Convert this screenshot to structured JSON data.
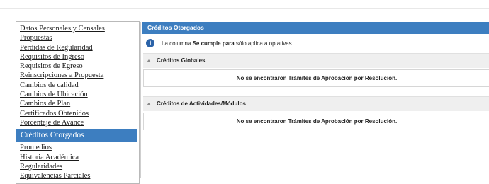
{
  "sidebar": {
    "items": [
      {
        "label": "Datos Personales y Censales",
        "active": false
      },
      {
        "label": "Propuestas",
        "active": false
      },
      {
        "label": "Pérdidas de Regularidad",
        "active": false
      },
      {
        "label": "Requisitos de Ingreso",
        "active": false
      },
      {
        "label": "Requisitos de Egreso",
        "active": false
      },
      {
        "label": "Reinscripciones a Propuesta",
        "active": false
      },
      {
        "label": "Cambios de calidad",
        "active": false
      },
      {
        "label": "Cambios de Ubicación",
        "active": false
      },
      {
        "label": "Cambios de Plan",
        "active": false
      },
      {
        "label": "Certificados Obtenidos",
        "active": false
      },
      {
        "label": "Porcentaje de Avance",
        "active": false
      },
      {
        "label": "Créditos Otorgados",
        "active": true
      },
      {
        "label": "Promedios",
        "active": false
      },
      {
        "label": "Historia Académica",
        "active": false
      },
      {
        "label": "Regularidades",
        "active": false
      },
      {
        "label": "Equivalencias Parciales",
        "active": false
      }
    ]
  },
  "main": {
    "title": "Créditos Otorgados",
    "info": {
      "prefix": "La columna",
      "bold": "Se cumple para",
      "suffix": "sólo aplica a optativas.",
      "icon": "info-icon"
    },
    "sections": [
      {
        "title": "Créditos Globales",
        "message": "No se encontraron Trámites de Aprobación por Resolución."
      },
      {
        "title": "Créditos de Actividades/Módulos",
        "message": "No se encontraron Trámites de Aprobación por Resolución."
      }
    ]
  },
  "colors": {
    "accent": "#3d7ec0",
    "section_bg": "#efefef"
  }
}
